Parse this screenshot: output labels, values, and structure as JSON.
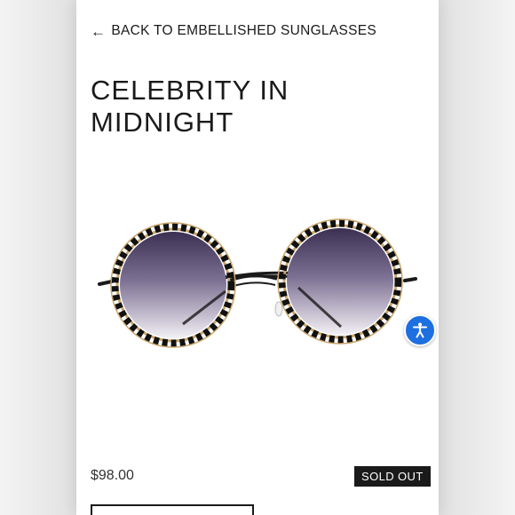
{
  "navigation": {
    "back_arrow": "←",
    "back_label": "BACK TO EMBELLISHED SUNGLASSES"
  },
  "product": {
    "title": "CELEBRITY IN MIDNIGHT",
    "price": "$98.00",
    "status_badge": "SOLD OUT",
    "image_icon": "sunglasses-image"
  },
  "accessibility": {
    "icon": "accessibility-icon",
    "color": "#1e6fe0"
  },
  "colors": {
    "text": "#1a1a1a",
    "badge_bg": "#1a1a1a",
    "badge_text": "#ffffff"
  }
}
